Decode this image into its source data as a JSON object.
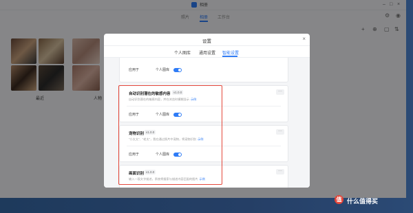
{
  "window": {
    "title": "相册"
  },
  "topnav": {
    "items": [
      "照片",
      "相册",
      "工作台"
    ],
    "active_index": 1
  },
  "albums": [
    {
      "label": "最近"
    },
    {
      "label": "人物"
    }
  ],
  "dialog": {
    "title": "设置",
    "close_label": "×",
    "tabs": [
      "个人图库",
      "通用设置",
      "智能设置"
    ],
    "active_tab": 2,
    "top_card": {
      "apply_label": "应用于",
      "scope": "个人图库",
      "enabled": true
    },
    "cards": [
      {
        "title": "自动识别潜在的敏感内容",
        "version": "v1.0.0",
        "description": "自动识别潜在的敏感内容，并在浏览时模糊显示",
        "example_link": "示例",
        "apply_label": "应用于",
        "scope": "个人图库",
        "enabled": true
      },
      {
        "title": "宠物识别",
        "version": "v1.0.0",
        "description": "\"小太太\"、\"老太\"，我在通过照片中宠物，将宠物识别",
        "example_link": "示例",
        "apply_label": "应用于",
        "scope": "个人图库",
        "enabled": true
      },
      {
        "title": "画面识别",
        "version": "v1.0.0",
        "description": "输入一段文字描述，系统将搜索与描述内容匹配的图片",
        "example_link": "示例",
        "more_label": "···"
      }
    ]
  },
  "colors": {
    "accent": "#2f7cf6",
    "highlight_box": "#e4463a"
  },
  "watermark": {
    "text": "什么值得买",
    "badge": "值"
  }
}
